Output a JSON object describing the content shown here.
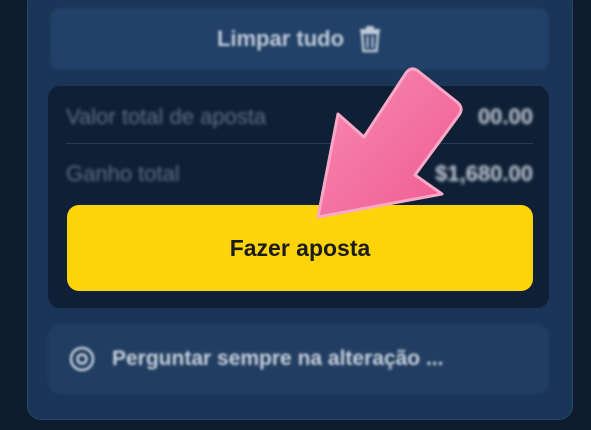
{
  "bet_slip": {
    "clear_all_label": "Limpar tudo",
    "clear_icon": "trash-icon",
    "total_stake_label": "Valor total de aposta",
    "total_stake_value": "00.00",
    "total_win_label": "Ganho total",
    "total_win_value": "$1,680.00",
    "place_bet_label": "Fazer aposta",
    "odds_change_label": "Perguntar sempre na alteração ...",
    "odds_change_icon": "gear-icon"
  },
  "colors": {
    "background": "#0e1b2d",
    "panel": "#1a3557",
    "accent_yellow": "#fdd409",
    "arrow_pink": "#f46a9b"
  },
  "overlay": {
    "pointer": "pink-arrow-icon"
  }
}
